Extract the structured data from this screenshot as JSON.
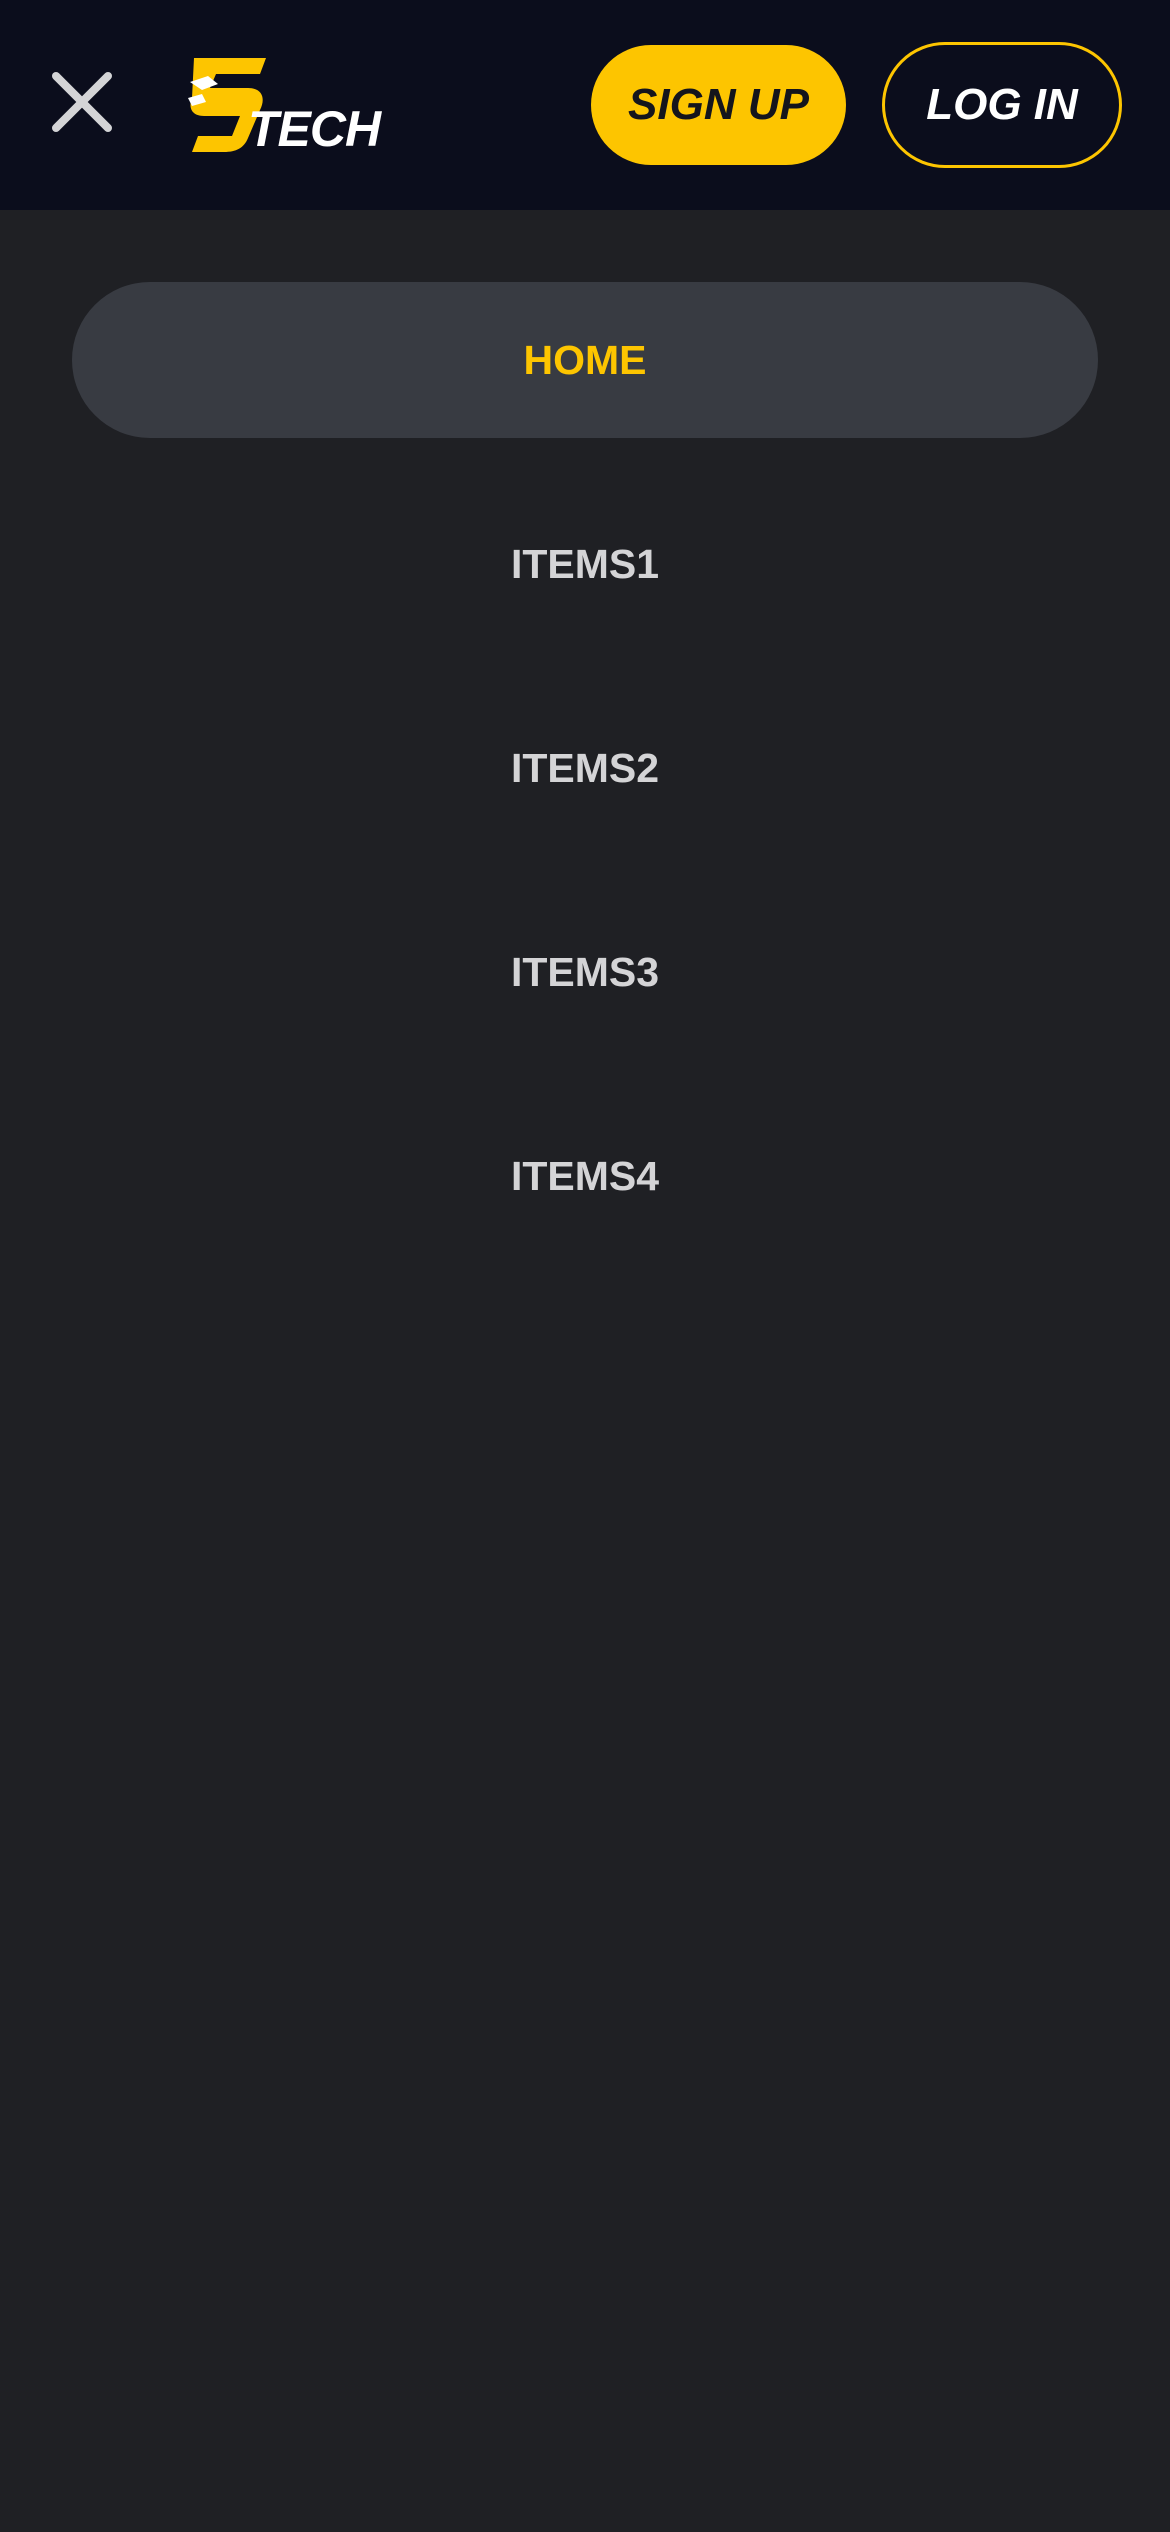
{
  "header": {
    "close_icon": "close-icon",
    "logo_text": "TECH",
    "signup_label": "SIGN UP",
    "login_label": "LOG IN"
  },
  "menu": {
    "items": [
      {
        "label": "HOME",
        "active": true
      },
      {
        "label": "ITEMS1",
        "active": false
      },
      {
        "label": "ITEMS2",
        "active": false
      },
      {
        "label": "ITEMS3",
        "active": false
      },
      {
        "label": "ITEMS4",
        "active": false
      }
    ]
  },
  "colors": {
    "header_bg": "#0b0d1c",
    "page_bg": "#1f2024",
    "accent": "#fdc500",
    "active_item_bg": "#383b42",
    "menu_text": "#d4d4d6"
  }
}
